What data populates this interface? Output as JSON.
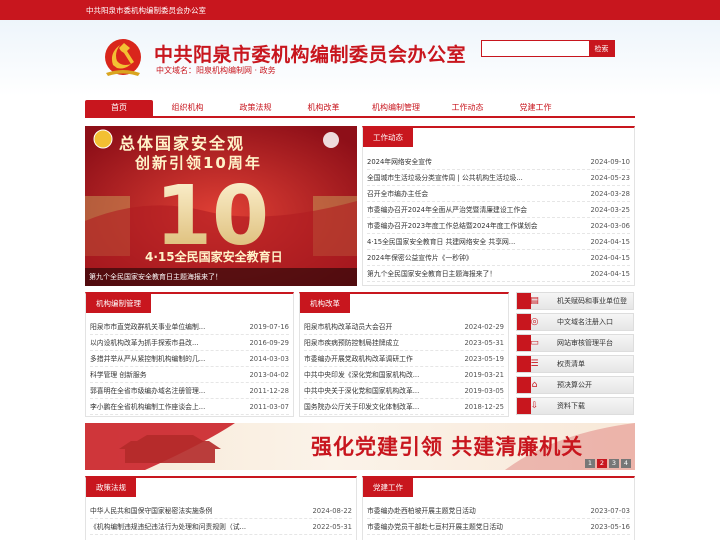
{
  "topbar": {
    "text": "中共阳泉市委机构编制委员会办公室"
  },
  "header": {
    "title": "中共阳泉市委机构编制委员会办公室",
    "subtitle": "中文域名：阳泉机构编制网 · 政务"
  },
  "search": {
    "placeholder": "",
    "button": "检索"
  },
  "nav": [
    "首页",
    "组织机构",
    "政策法规",
    "机构改革",
    "机构编制管理",
    "工作动态",
    "党建工作"
  ],
  "slide": {
    "caption": "第九个全民国家安全教育日主题海报来了！",
    "text_line1": "总体国家安全观",
    "text_line2": "创新引领10周年",
    "big_number": "10",
    "text_bottom": "4·15全民国家安全教育日"
  },
  "work_news": {
    "tab": "工作动态",
    "items": [
      {
        "title": "2024年网络安全宣传",
        "date": "2024-09-10"
      },
      {
        "title": "全国城市生活垃圾分类宣传周 | 公共机构生活垃圾...",
        "date": "2024-05-23"
      },
      {
        "title": "召开全市编办主任会",
        "date": "2024-03-28"
      },
      {
        "title": "市委编办召开2024年全面从严治党暨清廉建设工作会",
        "date": "2024-03-25"
      },
      {
        "title": "市委编办召开2023年度工作总结暨2024年度工作谋划会",
        "date": "2024-03-06"
      },
      {
        "title": "4·15全民国家安全教育日 共建网络安全 共享网...",
        "date": "2024-04-15"
      },
      {
        "title": "2024年保密公益宣传片《一秒钟》",
        "date": "2024-04-15"
      },
      {
        "title": "第九个全民国家安全教育日主题海报来了！",
        "date": "2024-04-15"
      }
    ]
  },
  "org_mgmt": {
    "tab": "机构编制管理",
    "items": [
      {
        "title": "阳泉市市直党政群机关事业单位编制...",
        "date": "2019-07-16"
      },
      {
        "title": "以内设机构改革为抓手探索市县改...",
        "date": "2016-09-29"
      },
      {
        "title": "多措并举从严从紧控制机构编制的几...",
        "date": "2014-03-03"
      },
      {
        "title": "科学管理 创新服务",
        "date": "2013-04-02"
      },
      {
        "title": "郭喜明在全省市级编办域名注册管理...",
        "date": "2011-12-28"
      },
      {
        "title": "李小鹏在全省机构编制工作座谈会上...",
        "date": "2011-03-07"
      }
    ]
  },
  "reform": {
    "tab": "机构改革",
    "items": [
      {
        "title": "阳泉市机构改革动员大会召开",
        "date": "2024-02-29"
      },
      {
        "title": "阳泉市疾病预防控制局挂牌成立",
        "date": "2023-05-31"
      },
      {
        "title": "市委编办开展党政机构改革调研工作",
        "date": "2023-05-19"
      },
      {
        "title": "中共中央印发《深化党和国家机构改...",
        "date": "2019-03-21"
      },
      {
        "title": "中共中央关于深化党和国家机构改革...",
        "date": "2019-03-05"
      },
      {
        "title": "国务院办公厅关于印发文化体制改革...",
        "date": "2018-12-25"
      }
    ]
  },
  "sidebar": [
    {
      "label": "机关赋码和事业单位登",
      "icon": "registration-icon"
    },
    {
      "label": "中文域名注册入口",
      "icon": "globe-icon"
    },
    {
      "label": "网站审核管理平台",
      "icon": "monitor-icon"
    },
    {
      "label": "权责清单",
      "icon": "list-icon"
    },
    {
      "label": "预决算公开",
      "icon": "house-icon"
    },
    {
      "label": "资料下载",
      "icon": "download-icon"
    }
  ],
  "banner": {
    "text": "强化党建引领  共建清廉机关",
    "pages": [
      "1",
      "2",
      "3",
      "4"
    ]
  },
  "policy": {
    "tab": "政策法规",
    "items": [
      {
        "title": "中华人民共和国保守国家秘密法实施条例",
        "date": "2024-08-22"
      },
      {
        "title": "《机构编制违规违纪违法行为处理和问责规则（试...",
        "date": "2022-05-31"
      }
    ]
  },
  "party": {
    "tab": "党建工作",
    "items": [
      {
        "title": "市委编办赴西柏坡开展主题党日活动",
        "date": "2023-07-03"
      },
      {
        "title": "市委编办党员干部赴七亘村开展主题党日活动",
        "date": "2023-05-16"
      }
    ]
  },
  "colors": {
    "primary": "#c8161e",
    "gold": "#f3c033"
  }
}
